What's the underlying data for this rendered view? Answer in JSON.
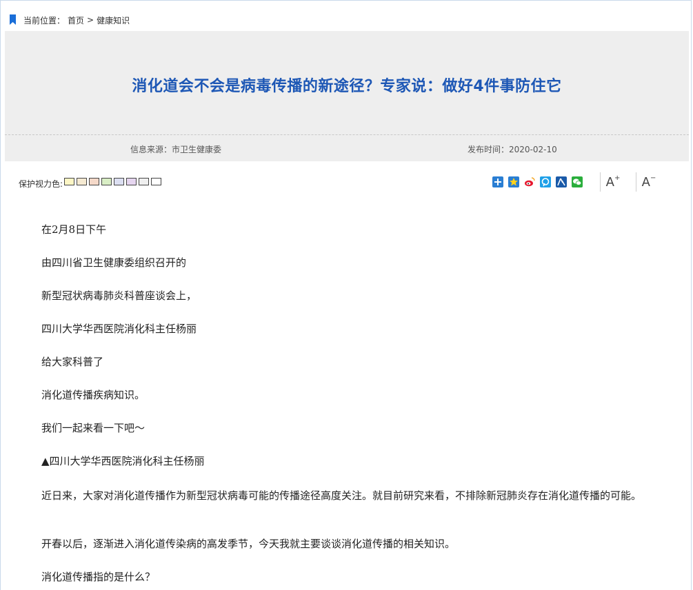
{
  "breadcrumb": {
    "prefix": "当前位置：",
    "home": "首页",
    "separator": ">",
    "current": "健康知识"
  },
  "article": {
    "title": "消化道会不会是病毒传播的新途径？专家说：做好4件事防住它",
    "source_label": "信息来源：市卫生健康委",
    "date_label": "发布时间：2020-02-10"
  },
  "toolbar": {
    "eye_protection_label": "保护视力色:",
    "swatch_colors": [
      "#fdf6c5",
      "#f5ead2",
      "#f5d9c9",
      "#d9eec5",
      "#dcdff2",
      "#e6d6f0",
      "#efefef",
      "#ffffff"
    ],
    "share_icons": [
      "plus-share-icon",
      "qzone-icon",
      "weibo-icon",
      "tencent-weibo-icon",
      "renren-icon",
      "wechat-icon"
    ],
    "font_increase": "A",
    "font_decrease": "A",
    "font_increase_sign": "+",
    "font_decrease_sign": "−"
  },
  "paragraphs": [
    "在2月8日下午",
    "由四川省卫生健康委组织召开的",
    "新型冠状病毒肺炎科普座谈会上，",
    "四川大学华西医院消化科主任杨丽",
    "给大家科普了",
    "消化道传播疾病知识。",
    "我们一起来看一下吧～",
    "▲四川大学华西医院消化科主任杨丽",
    "近日来，大家对消化道传播作为新型冠状病毒可能的传播途径高度关注。就目前研究来看，不排除新冠肺炎存在消化道传播的可能。",
    "开春以后，逐渐进入消化道传染病的高发季节，今天我就主要谈谈消化道传播的相关知识。",
    "消化道传播指的是什么？"
  ],
  "colors": {
    "title_blue": "#1d57b5",
    "panel_gray": "#eeeeee",
    "bookmark_blue": "#1a6ed8"
  }
}
